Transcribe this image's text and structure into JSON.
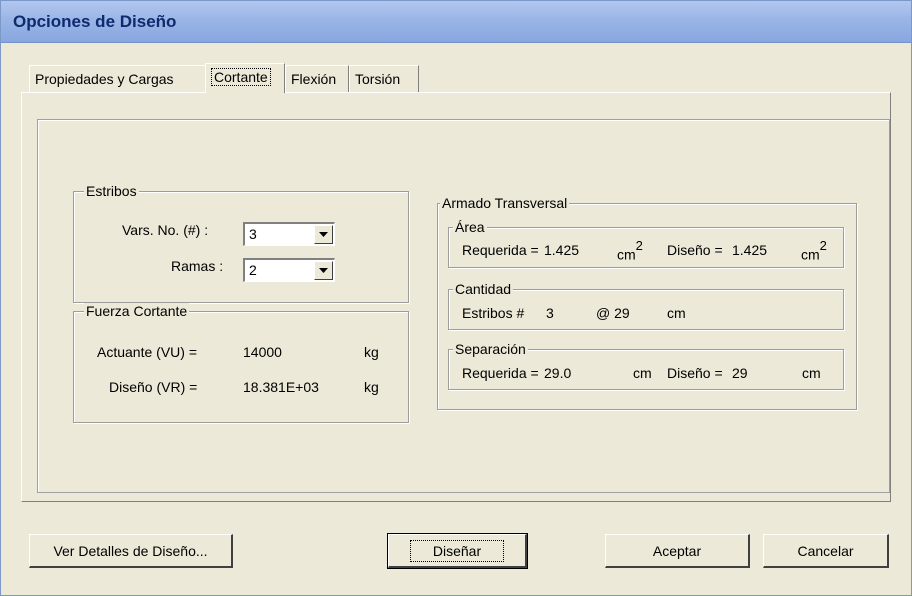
{
  "window": {
    "title": "Opciones de Diseño"
  },
  "tabs": [
    {
      "label": "Propiedades y Cargas",
      "active": false
    },
    {
      "label": "Cortante",
      "active": true
    },
    {
      "label": "Flexión",
      "active": false
    },
    {
      "label": "Torsión",
      "active": false
    }
  ],
  "estribos": {
    "title": "Estribos",
    "vars_label": "Vars. No. (#) :",
    "vars_value": "3",
    "ramas_label": "Ramas :",
    "ramas_value": "2"
  },
  "fuerza": {
    "title": "Fuerza Cortante",
    "actuante_label": "Actuante (VU) =",
    "actuante_value": "14000",
    "actuante_unit": "kg",
    "diseno_label": "Diseño (VR) =",
    "diseno_value": "18.381E+03",
    "diseno_unit": "kg"
  },
  "armado": {
    "title": "Armado Transversal",
    "area": {
      "title": "Área",
      "req_label": "Requerida =",
      "req_value": "1.425",
      "req_unit": "cm",
      "exp": "2",
      "dis_label": "Diseño =",
      "dis_value": "1.425",
      "dis_unit": "cm"
    },
    "cantidad": {
      "title": "Cantidad",
      "label": "Estribos #",
      "num": "3",
      "at": "@ 29",
      "unit": "cm"
    },
    "separacion": {
      "title": "Separación",
      "req_label": "Requerida =",
      "req_value": "29.0",
      "req_unit": "cm",
      "dis_label": "Diseño =",
      "dis_value": "29",
      "dis_unit": "cm"
    }
  },
  "buttons": {
    "detalles": "Ver Detalles de Diseño...",
    "disenar": "Diseñar",
    "aceptar": "Aceptar",
    "cancelar": "Cancelar"
  }
}
